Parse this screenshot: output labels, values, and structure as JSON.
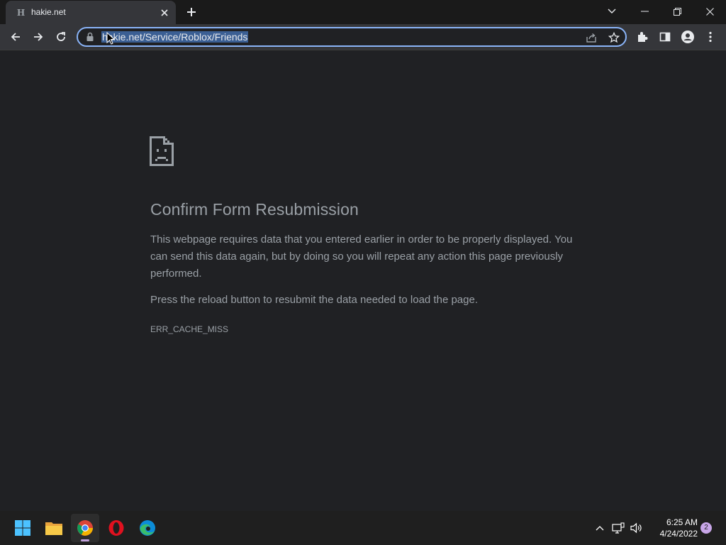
{
  "browser": {
    "tab": {
      "title": "hakie.net",
      "favicon_text": "H"
    },
    "omnibox": {
      "url": "hakie.net/Service/Roblox/Friends"
    }
  },
  "error_page": {
    "title": "Confirm Form Resubmission",
    "description": "This webpage requires data that you entered earlier in order to be properly displayed. You can send this data again, but by doing so you will repeat any action this page previously performed.",
    "hint": "Press the reload button to resubmit the data needed to load the page.",
    "code": "ERR_CACHE_MISS"
  },
  "taskbar": {
    "apps": [
      "start-icon",
      "file-explorer-icon",
      "chrome-icon",
      "opera-icon",
      "edge-icon"
    ],
    "time": "6:25 AM",
    "date": "4/24/2022",
    "notification_count": "2"
  },
  "colors": {
    "page_bg": "#202124",
    "toolbar_bg": "#35363a",
    "tabstrip_bg": "#1a1a1a",
    "text": "#9aa0a6",
    "omnibox_focus": "#8ab4f8",
    "url_selection": "#3b5f94"
  }
}
